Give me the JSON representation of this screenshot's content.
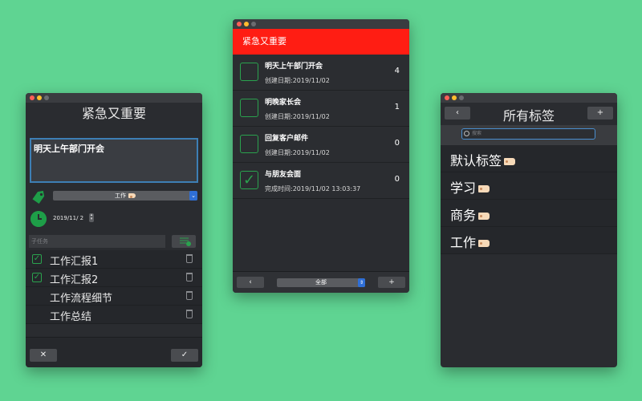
{
  "left_window": {
    "title": "紧急又重要",
    "task_text": "明天上午部门开会",
    "tag_select": "工作",
    "date_value": "2019/11/  2",
    "subtask_placeholder": "子任务",
    "subtasks": [
      {
        "label": "工作汇报1",
        "checked": true
      },
      {
        "label": "工作汇报2",
        "checked": true
      },
      {
        "label": "工作流程细节",
        "checked": false
      },
      {
        "label": "工作总结",
        "checked": false
      }
    ],
    "cancel_label": "✕",
    "confirm_label": "✓"
  },
  "middle_window": {
    "title": "紧急又重要",
    "todos": [
      {
        "name": "明天上午部门开会",
        "date": "创建日期:2019/11/02",
        "count": "4",
        "checked": false
      },
      {
        "name": "明晚家长会",
        "date": "创建日期:2019/11/02",
        "count": "1",
        "checked": false
      },
      {
        "name": "回复客户邮件",
        "date": "创建日期:2019/11/02",
        "count": "0",
        "checked": false
      },
      {
        "name": "与朋友会面",
        "date": "完成时间:2019/11/02 13:03:37",
        "count": "0",
        "checked": true
      }
    ],
    "back_label": "‹",
    "filter_value": "全部",
    "add_label": "+"
  },
  "right_window": {
    "title": "所有标签",
    "back_label": "‹",
    "add_label": "+",
    "search_placeholder": "搜索",
    "tags": [
      "默认标签",
      "学习",
      "商务",
      "工作"
    ]
  },
  "colors": {
    "background": "#5fd492",
    "accent_red": "#ff1d13",
    "check_green": "#2aa24e",
    "focus_blue": "#3d7fb5"
  }
}
